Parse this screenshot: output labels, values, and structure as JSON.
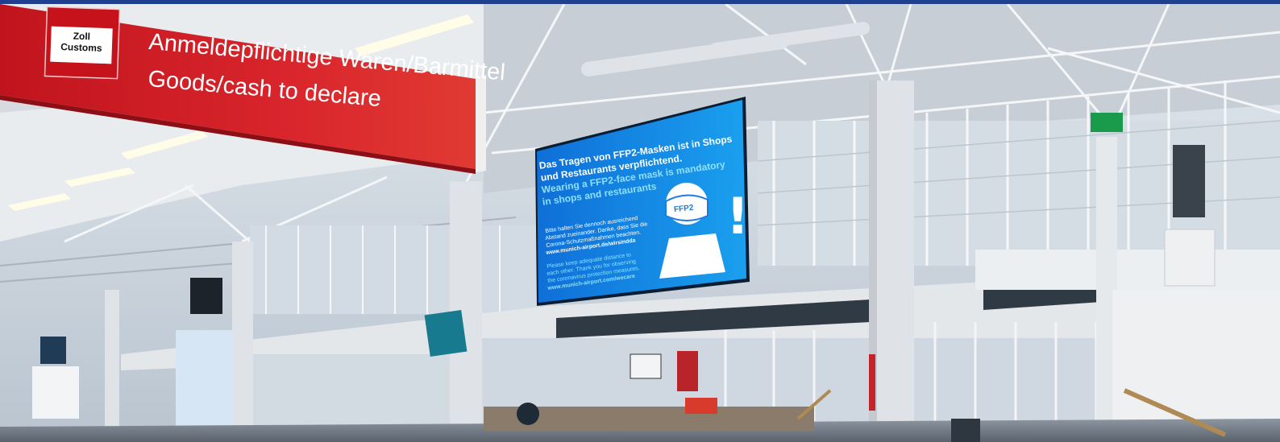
{
  "scene": {
    "description_colors": {
      "customs_sign_red": "#d21f26",
      "screen_blue": "#1586e6",
      "screen_cyan_text": "#8ee0ff",
      "ceiling_white": "#eef1f4",
      "top_bar": "#1f3f8f"
    }
  },
  "customs_sign": {
    "logo_line1": "Zoll",
    "logo_line2": "Customs",
    "line1": "Anmeldepflichtige Waren/Barmittel",
    "line2": "Goods/cash to declare"
  },
  "screen": {
    "de_line1": "Das Tragen von FFP2-Masken ist in Shops",
    "de_line2": "und Restaurants verpflichtend.",
    "en_line1": "Wearing a FFP2-face mask is mandatory",
    "en_line2": "in shops and restaurants",
    "small_de1": "Bitte halten Sie dennoch ausreichend",
    "small_de2": "Abstand zueinander. Danke, dass Sie die",
    "small_de3": "Corona-Schutzmaßnahmen beachten.",
    "url_de": "www.munich-airport.de/wirsindda",
    "small_en1": "Please keep adequate distance to",
    "small_en2": "each other. Thank you for observing",
    "small_en3": "the coronavirus protection measures.",
    "url_en": "www.munich-airport.com/wecare",
    "mask_label": "FFP2",
    "exclaim": "!"
  }
}
